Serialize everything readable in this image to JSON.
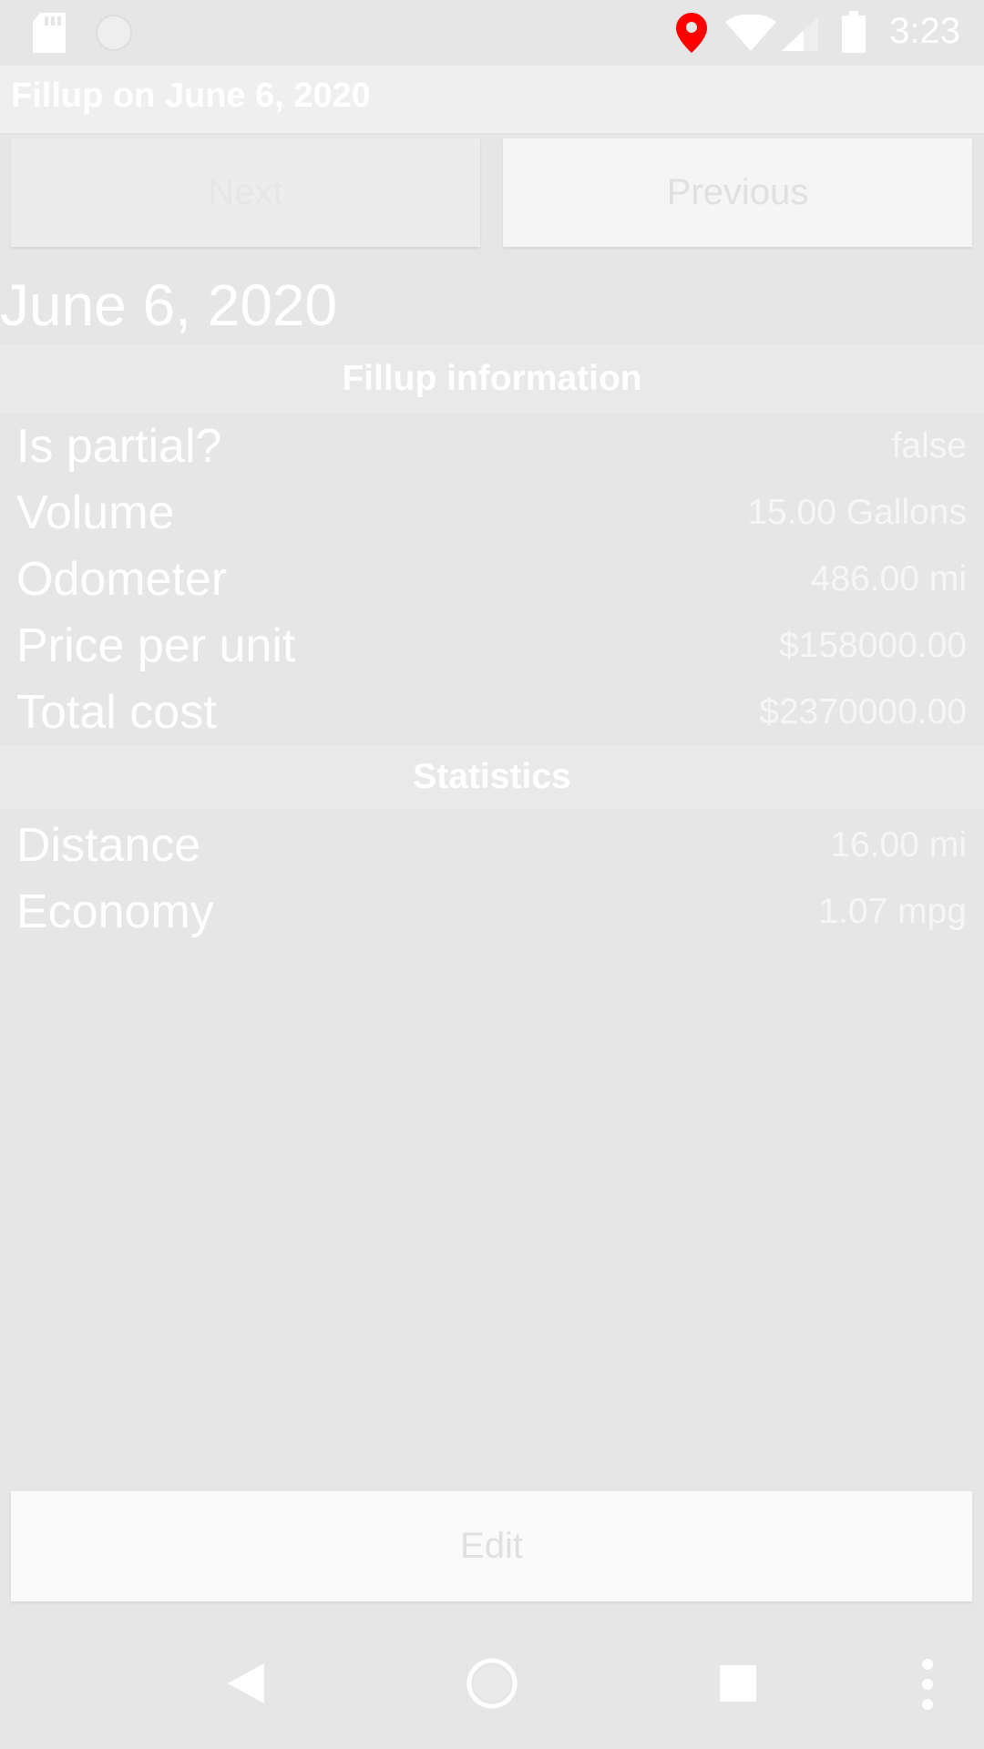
{
  "status_bar": {
    "time": "3:23",
    "icons": [
      "sd-card-icon",
      "circle-notification-icon",
      "location-pin-icon",
      "wifi-icon",
      "cell-signal-icon",
      "battery-icon"
    ],
    "location_pin_color": "#ff0000"
  },
  "app_bar": {
    "title": "Fillup on June 6, 2020"
  },
  "nav_buttons": {
    "next_label": "Next",
    "previous_label": "Previous"
  },
  "date_heading": "June 6, 2020",
  "fillup_section": {
    "header": "Fillup information",
    "rows": [
      {
        "label": "Is partial?",
        "value": "false"
      },
      {
        "label": "Volume",
        "value": "15.00 Gallons"
      },
      {
        "label": "Odometer",
        "value": "486.00 mi"
      },
      {
        "label": "Price per unit",
        "value": "$158000.00"
      },
      {
        "label": "Total cost",
        "value": "$2370000.00"
      }
    ]
  },
  "statistics_section": {
    "header": "Statistics",
    "rows": [
      {
        "label": "Distance",
        "value": "16.00 mi"
      },
      {
        "label": "Economy",
        "value": "1.07 mpg"
      }
    ]
  },
  "edit_button": {
    "label": "Edit"
  },
  "system_nav": {
    "icons": [
      "back-icon",
      "home-icon",
      "recents-icon",
      "overflow-menu-icon"
    ]
  }
}
